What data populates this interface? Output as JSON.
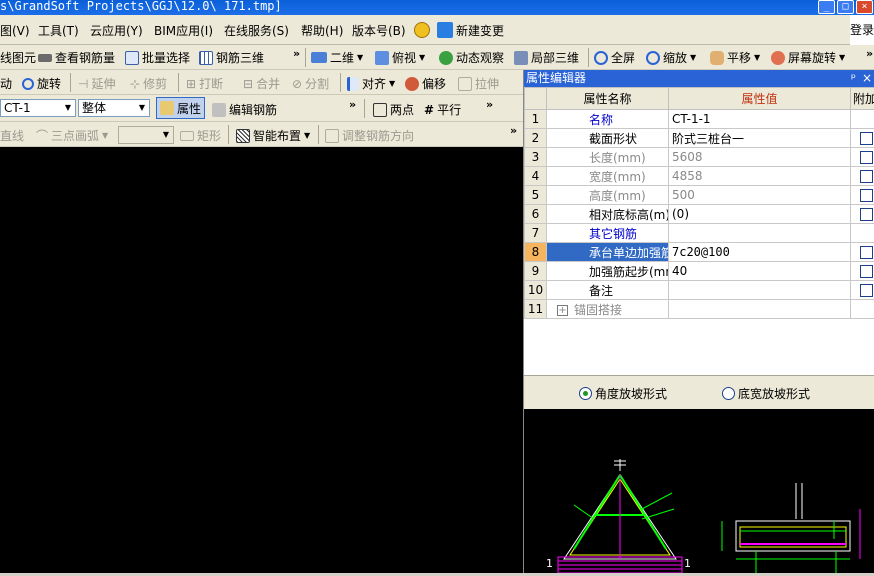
{
  "window": {
    "title": "s\\GrandSoft Projects\\GGJ\\12.0\\ 171.tmp]"
  },
  "menu": {
    "items": [
      "图(V)",
      "工具(T)",
      "云应用(Y)",
      "BIM应用(I)",
      "在线服务(S)",
      "帮助(H)",
      "版本号(B)",
      "新建变更"
    ],
    "login": "登录"
  },
  "toolbar1": {
    "items": [
      "线图元",
      "查看钢筋量",
      "批量选择",
      "钢筋三维",
      "二维",
      "俯视",
      "动态观察",
      "局部三维",
      "全屏",
      "缩放",
      "平移",
      "屏幕旋转"
    ]
  },
  "toolbar2": {
    "items": [
      "动",
      "旋转",
      "延伸",
      "修剪",
      "打断",
      "合并",
      "分割",
      "对齐",
      "偏移",
      "拉伸"
    ]
  },
  "toolbar3": {
    "component_value": "CT-1",
    "scope_value": "整体",
    "items": [
      "属性",
      "编辑钢筋",
      "两点",
      "平行"
    ]
  },
  "toolbar4": {
    "items": [
      "直线",
      "三点画弧",
      "矩形",
      "智能布置",
      "调整钢筋方向"
    ]
  },
  "panel": {
    "title": "属性编辑器",
    "columns": [
      "属性名称",
      "属性值",
      "附加"
    ],
    "rows": [
      {
        "num": "1",
        "name": "名称",
        "value": "CT-1-1",
        "style": "blue",
        "check": false
      },
      {
        "num": "2",
        "name": "截面形状",
        "value": "阶式三桩台一",
        "style": "normal",
        "check": true
      },
      {
        "num": "3",
        "name": "长度(mm)",
        "value": "5608",
        "style": "gray",
        "check": true
      },
      {
        "num": "4",
        "name": "宽度(mm)",
        "value": "4858",
        "style": "gray",
        "check": true
      },
      {
        "num": "5",
        "name": "高度(mm)",
        "value": "500",
        "style": "gray",
        "check": true
      },
      {
        "num": "6",
        "name": "相对底标高(m)",
        "value": "(0)",
        "style": "normal",
        "check": true
      },
      {
        "num": "7",
        "name": "其它钢筋",
        "value": "",
        "style": "blue",
        "check": false
      },
      {
        "num": "8",
        "name": "承台单边加强筋",
        "value": "7c20@100",
        "style": "selected",
        "check": true
      },
      {
        "num": "9",
        "name": "加强筋起步(mm)",
        "value": "40",
        "style": "normal",
        "check": true
      },
      {
        "num": "10",
        "name": "备注",
        "value": "",
        "style": "normal",
        "check": true
      },
      {
        "num": "11",
        "name": "锚固搭接",
        "value": "",
        "style": "expand",
        "check": false
      }
    ],
    "radio_angle": "角度放坡形式",
    "radio_width": "底宽放坡形式"
  },
  "colors": {
    "title_bar": "#0a5fd9",
    "panel_title": "#2a63d6",
    "selection": "#316ac5",
    "row_highlight": "#f5b55f",
    "canvas": "#000000"
  }
}
